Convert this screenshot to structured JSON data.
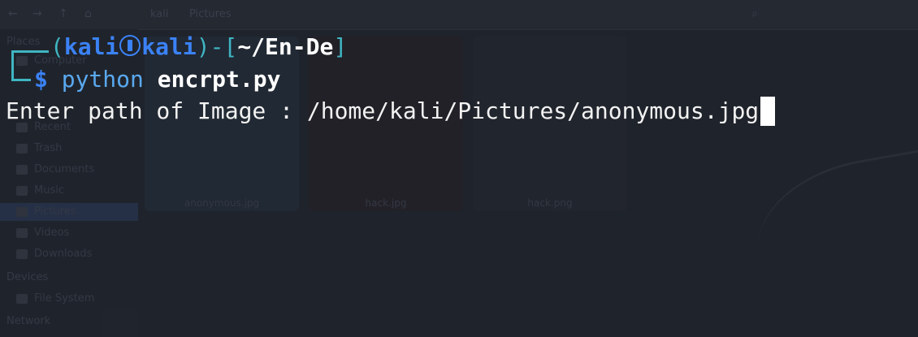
{
  "file_manager": {
    "path": [
      "kali",
      "Pictures"
    ],
    "sidebar": {
      "places_label": "Places",
      "devices_label": "Devices",
      "network_label": "Network",
      "items": [
        "Computer",
        "Recent",
        "Trash",
        "Documents",
        "Music",
        "Pictures",
        "Videos",
        "Downloads"
      ],
      "device_items": [
        "File System"
      ]
    },
    "files": [
      {
        "name": "anonymous.jpg"
      },
      {
        "name": "hack.jpg"
      },
      {
        "name": "hack.png"
      }
    ]
  },
  "terminal": {
    "prompt": {
      "open": "(",
      "user": "kali",
      "host": "kali",
      "close": ")-[",
      "cwd": "~/En-De",
      "end": "]",
      "symbol": "$",
      "command": "python",
      "arg": "encrpt.py"
    },
    "output_line": "Enter path of Image : /home/kali/Pictures/anonymous.jpg"
  },
  "colors": {
    "background": "#1f232b",
    "teal": "#3fb5c2",
    "blue": "#3b82f6",
    "text": "#f2f2f2"
  }
}
